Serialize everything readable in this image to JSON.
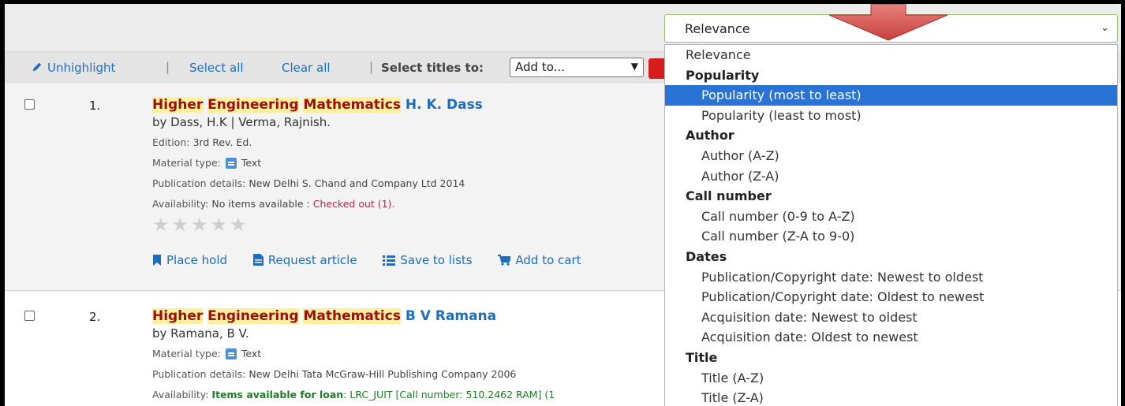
{
  "toolbar": {
    "unhighlight": "Unhighlight",
    "select_all": "Select all",
    "clear_all": "Clear all",
    "select_titles_label": "Select titles to:",
    "add_to_value": "Add to..."
  },
  "sort": {
    "selected": "Relevance",
    "options": [
      {
        "type": "option",
        "label": "Relevance",
        "selected": false
      },
      {
        "type": "group",
        "label": "Popularity"
      },
      {
        "type": "option",
        "label": "Popularity (most to least)",
        "selected": true
      },
      {
        "type": "option",
        "label": "Popularity (least to most)",
        "selected": false
      },
      {
        "type": "group",
        "label": "Author"
      },
      {
        "type": "option",
        "label": "Author (A-Z)",
        "selected": false
      },
      {
        "type": "option",
        "label": "Author (Z-A)",
        "selected": false
      },
      {
        "type": "group",
        "label": "Call number"
      },
      {
        "type": "option",
        "label": "Call number (0-9 to A-Z)",
        "selected": false
      },
      {
        "type": "option",
        "label": "Call number (Z-A to 9-0)",
        "selected": false
      },
      {
        "type": "group",
        "label": "Dates"
      },
      {
        "type": "option",
        "label": "Publication/Copyright date: Newest to oldest",
        "selected": false
      },
      {
        "type": "option",
        "label": "Publication/Copyright date: Oldest to newest",
        "selected": false
      },
      {
        "type": "option",
        "label": "Acquisition date: Newest to oldest",
        "selected": false
      },
      {
        "type": "option",
        "label": "Acquisition date: Oldest to newest",
        "selected": false
      },
      {
        "type": "group",
        "label": "Title"
      },
      {
        "type": "option",
        "label": "Title (A-Z)",
        "selected": false
      },
      {
        "type": "option",
        "label": "Title (Z-A)",
        "selected": false
      }
    ]
  },
  "results": [
    {
      "number": "1.",
      "title_highlight_1": "Higher",
      "title_plain_1": " ",
      "title_highlight_2": "Engineering",
      "title_plain_2": " ",
      "title_highlight_3": "Mathematics",
      "title_author": "H. K. Dass",
      "byline": "by Dass, H.K | Verma, Rajnish.",
      "edition_label": "Edition:",
      "edition_value": "3rd Rev. Ed.",
      "material_label": "Material type:",
      "material_value": "Text",
      "publication_label": "Publication details:",
      "publication_value": "New Delhi S. Chand and Company Ltd 2014",
      "availability_label": "Availability:",
      "availability_value": "No items available :",
      "availability_extra": "Checked out (1).",
      "rating": 0,
      "actions": {
        "place_hold": "Place hold",
        "request_article": "Request article",
        "save_to_lists": "Save to lists",
        "add_to_cart": "Add to cart"
      }
    },
    {
      "number": "2.",
      "title_highlight_1": "Higher",
      "title_highlight_2": "Engineering",
      "title_highlight_3": "Mathematics",
      "title_author": "B V Ramana",
      "byline": "by Ramana, B V.",
      "material_label": "Material type:",
      "material_value": "Text",
      "publication_label": "Publication details:",
      "publication_value": "New Delhi Tata McGraw-Hill Publishing Company 2006",
      "availability_label": "Availability:",
      "availability_value": "Items available for loan",
      "availability_extra": ": LRC_JUIT [Call number: 510.2462 RAM] (1"
    }
  ],
  "colors": {
    "link": "#1f6ebd",
    "highlight_bg": "#ffef9f",
    "highlight_text": "#9a1010",
    "selected_option": "#2a73d6",
    "arrow": "#d9534f"
  }
}
